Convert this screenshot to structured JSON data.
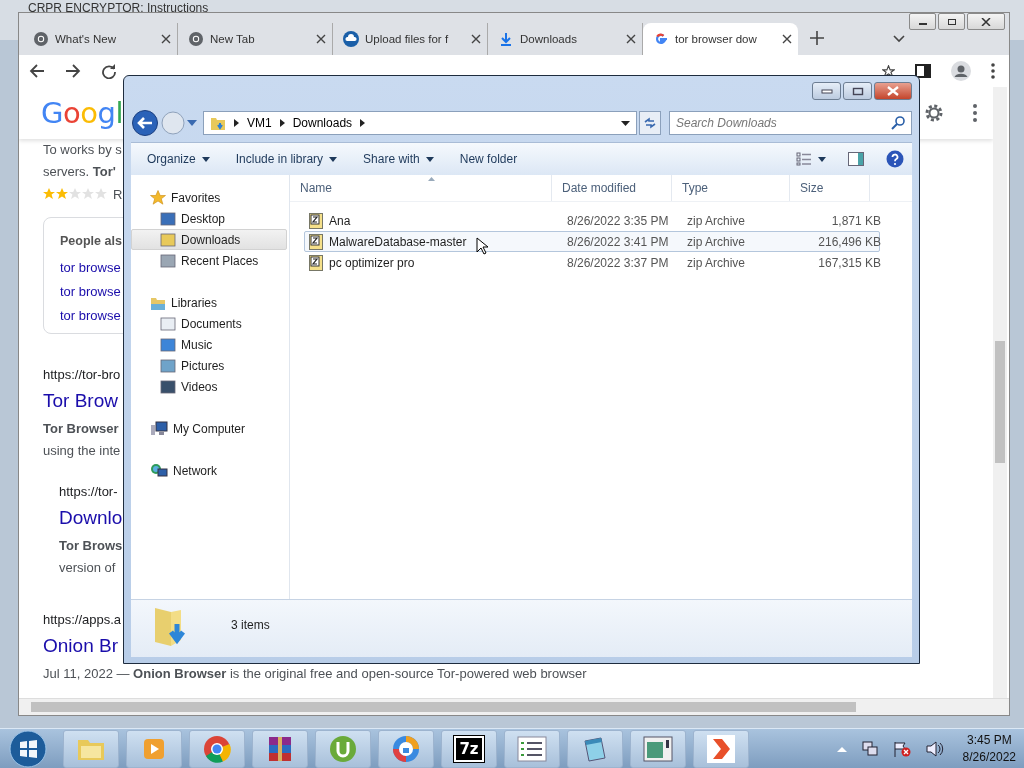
{
  "background_window": {
    "title": "CRPR ENCRYPTOR: Instructions"
  },
  "browser": {
    "tabs": [
      {
        "label": "What's New",
        "selected": false
      },
      {
        "label": "New Tab",
        "selected": false
      },
      {
        "label": "Upload files for f",
        "selected": false
      },
      {
        "label": "Downloads",
        "selected": false
      },
      {
        "label": "tor browser dow",
        "selected": true
      }
    ],
    "page": {
      "logo": "Googl",
      "top_snippet": [
        {
          "text": "To works by s",
          "bold": false
        },
        {
          "text": "servers. **Tor'**",
          "bold": false
        }
      ],
      "rating": {
        "stars": 2,
        "text": "R"
      },
      "people_also_ask": {
        "title": "People als",
        "links": [
          "tor browse",
          "tor browse",
          "tor browse"
        ]
      },
      "results": [
        {
          "url": "https://tor-bro",
          "title": "Tor Brow",
          "snippet": [
            {
              "text": "Tor Browser",
              "bold": true
            },
            {
              "text": "using the inte",
              "bold": false
            }
          ],
          "children": [
            {
              "url": "https://tor-",
              "title": "Downlo",
              "snippet": [
                {
                  "text": "Tor Brows",
                  "bold": true
                },
                {
                  "text": "version of",
                  "bold": false
                }
              ]
            }
          ]
        },
        {
          "url": "https://apps.a",
          "title": "Onion Br",
          "snippet": [
            {
              "text": "Jul 11, 2022 — **Onion Browser** is the original free and open-source Tor-powered web browser",
              "bold": false
            }
          ]
        }
      ]
    }
  },
  "explorer": {
    "breadcrumb": [
      "VM1",
      "Downloads"
    ],
    "search_placeholder": "Search Downloads",
    "commands": [
      {
        "label": "Organize",
        "dropdown": true
      },
      {
        "label": "Include in library",
        "dropdown": true
      },
      {
        "label": "Share with",
        "dropdown": true
      },
      {
        "label": "New folder",
        "dropdown": false
      }
    ],
    "nav": [
      {
        "label": "Favorites",
        "selected": false,
        "children": [
          {
            "label": "Desktop",
            "selected": false
          },
          {
            "label": "Downloads",
            "selected": true
          },
          {
            "label": "Recent Places",
            "selected": false
          }
        ]
      },
      {
        "label": "Libraries",
        "selected": false,
        "children": [
          {
            "label": "Documents",
            "selected": false
          },
          {
            "label": "Music",
            "selected": false
          },
          {
            "label": "Pictures",
            "selected": false
          },
          {
            "label": "Videos",
            "selected": false
          }
        ]
      },
      {
        "label": "My Computer",
        "selected": false
      },
      {
        "label": "Network",
        "selected": false
      }
    ],
    "columns": [
      "Name",
      "Date modified",
      "Type",
      "Size"
    ],
    "files": [
      {
        "name": "Ana",
        "date": "8/26/2022 3:35 PM",
        "type": "zip Archive",
        "size": "1,871 KB",
        "selected": false
      },
      {
        "name": "MalwareDatabase-master",
        "date": "8/26/2022 3:41 PM",
        "type": "zip Archive",
        "size": "216,496 KB",
        "selected": true
      },
      {
        "name": "pc optimizer pro",
        "date": "8/26/2022 3:37 PM",
        "type": "zip Archive",
        "size": "167,315 KB",
        "selected": false
      }
    ],
    "status": "3 items"
  },
  "taskbar": {
    "archive_label": "7z",
    "clock": {
      "time": "3:45 PM",
      "date": "8/26/2022"
    }
  }
}
